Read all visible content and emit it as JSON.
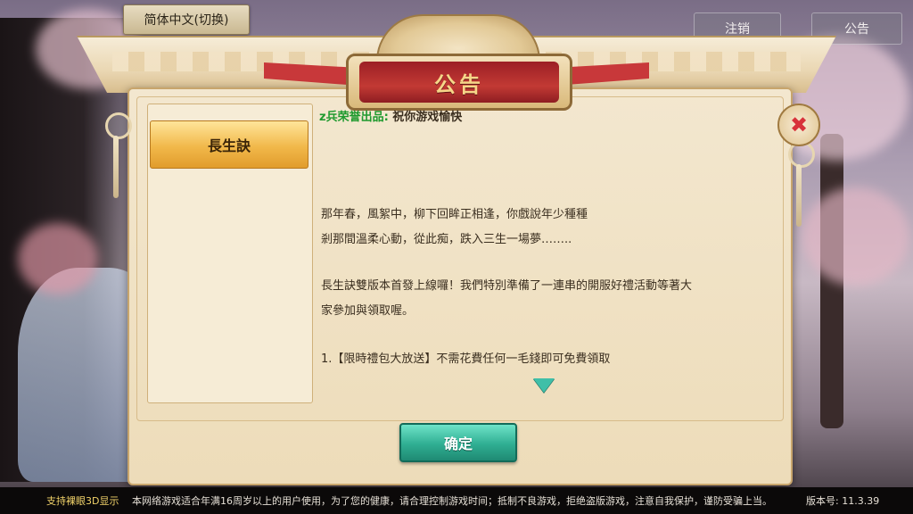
{
  "top_bar": {
    "language_button": "简体中文(切换)",
    "logout_button": "注销",
    "notice_button": "公告"
  },
  "dialog": {
    "title": "公告",
    "tabs": [
      {
        "label": "長生訣",
        "selected": true
      }
    ],
    "header_source": "z兵荣誉出品:",
    "header_text": "祝你游戏愉快",
    "paragraphs": [
      "那年春，風絮中，柳下回眸正相逢，你戲說年少種種",
      "剎那間溫柔心動，從此痴，跌入三生一場夢……..",
      "長生訣雙版本首發上線囉！我們特別準備了一連串的開服好禮活動等著大",
      "家參加與領取喔。",
      "1.【限時禮包大放送】不需花費任何一毛錢即可免費領取"
    ],
    "confirm_button": "确定"
  },
  "footer": {
    "left_text": "支持裸眼3D显示",
    "notice_text": "本网络游戏适合年满16周岁以上的用户使用，为了您的健康，请合理控制游戏时间；抵制不良游戏，拒绝盗版游戏，注意自我保护，谨防受骗上当。",
    "version_text": "版本号:  11.3.39"
  },
  "colors": {
    "accent_gold": "#f1b84a",
    "confirm_teal": "#2fae92",
    "title_red": "#c23a34",
    "source_green": "#1f9a2f"
  }
}
